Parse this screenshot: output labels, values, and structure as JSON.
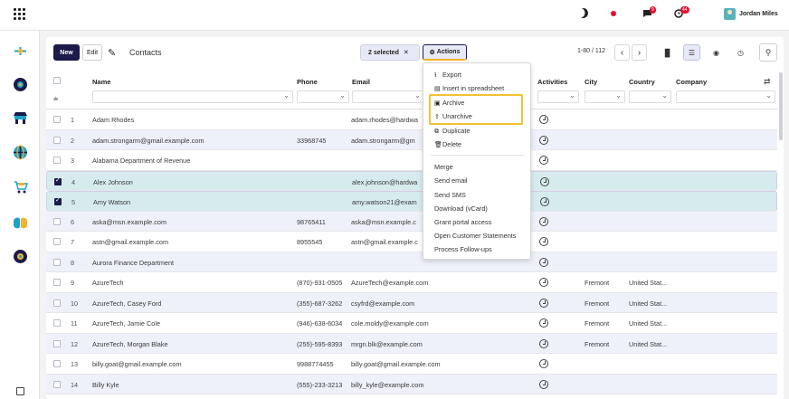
{
  "topbar": {
    "user_name": "Jordan Miles",
    "chat_badge": "9",
    "activity_badge": "44"
  },
  "toolbar": {
    "new_label": "New",
    "edit_label": "Edit",
    "breadcrumb": "Contacts",
    "selected_label": "2 selected",
    "actions_label": "Actions",
    "pager_text": "1-80 / 112"
  },
  "columns": {
    "name": "Name",
    "phone": "Phone",
    "email": "Email",
    "activities": "Activities",
    "city": "City",
    "country": "Country",
    "company": "Company"
  },
  "rows": [
    {
      "idx": "1",
      "name": "Adam Rhodes",
      "phone": "",
      "email": "adam.rhodes@hardwa",
      "city": "",
      "country": "",
      "checked": false
    },
    {
      "idx": "2",
      "name": "adam.strongarm@gmail.example.com",
      "phone": "33968745",
      "email": "adam.strongarm@gm",
      "city": "",
      "country": "",
      "checked": false
    },
    {
      "idx": "3",
      "name": "Alabama Department of Revenue",
      "phone": "",
      "email": "",
      "city": "",
      "country": "",
      "checked": false
    },
    {
      "idx": "4",
      "name": "Alex Johnson",
      "phone": "",
      "email": "alex.johnson@hardwa",
      "city": "",
      "country": "",
      "checked": true
    },
    {
      "idx": "5",
      "name": "Amy Watson",
      "phone": "",
      "email": "amy.watson21@exam",
      "city": "",
      "country": "",
      "checked": true
    },
    {
      "idx": "6",
      "name": "aska@msn.example.com",
      "phone": "98765411",
      "email": "aska@msn.example.c",
      "city": "",
      "country": "",
      "checked": false
    },
    {
      "idx": "7",
      "name": "astn@gmail.example.com",
      "phone": "8955545",
      "email": "astn@gmail.example.c",
      "city": "",
      "country": "",
      "checked": false
    },
    {
      "idx": "8",
      "name": "Aurora Finance Department",
      "phone": "",
      "email": "",
      "city": "",
      "country": "",
      "checked": false
    },
    {
      "idx": "9",
      "name": "AzureTech",
      "phone": "(870)-931-0505",
      "email": "AzureTech@example.com",
      "city": "Fremont",
      "country": "United Stat...",
      "checked": false
    },
    {
      "idx": "10",
      "name": "AzureTech, Casey Ford",
      "phone": "(355)-687-3262",
      "email": "csyfrd@example.com",
      "city": "Fremont",
      "country": "United Stat...",
      "checked": false
    },
    {
      "idx": "11",
      "name": "AzureTech, Jamie Cole",
      "phone": "(946)-638-6034",
      "email": "cole.moldy@example.com",
      "city": "Fremont",
      "country": "United Stat...",
      "checked": false
    },
    {
      "idx": "12",
      "name": "AzureTech, Morgan Blake",
      "phone": "(255)-595-8393",
      "email": "mrgn.blk@example.com",
      "city": "Fremont",
      "country": "United Stat...",
      "checked": false
    },
    {
      "idx": "13",
      "name": "billy.goat@gmail.example.com",
      "phone": "9988774455",
      "email": "billy.goat@gmail.example.com",
      "city": "",
      "country": "",
      "checked": false
    },
    {
      "idx": "14",
      "name": "Billy Kyle",
      "phone": "(555)-233-3213",
      "email": "billy_kyle@example.com",
      "city": "",
      "country": "",
      "checked": false
    }
  ],
  "actions_menu": {
    "export": "Export",
    "insert": "Insert in spreadsheet",
    "archive": "Archive",
    "unarchive": "Unarchive",
    "duplicate": "Duplicate",
    "delete": "Delete",
    "merge": "Merge",
    "send_email": "Send email",
    "send_sms": "Send SMS",
    "download": "Download (vCard)",
    "grant": "Grant portal access",
    "open_statements": "Open Customer Statements",
    "process": "Process Follow-ups"
  },
  "colors": {
    "primary": "#1d1b4b",
    "highlight": "#f1c232",
    "selected_row": "#d5ebee",
    "alt_row": "#eef0fa"
  }
}
